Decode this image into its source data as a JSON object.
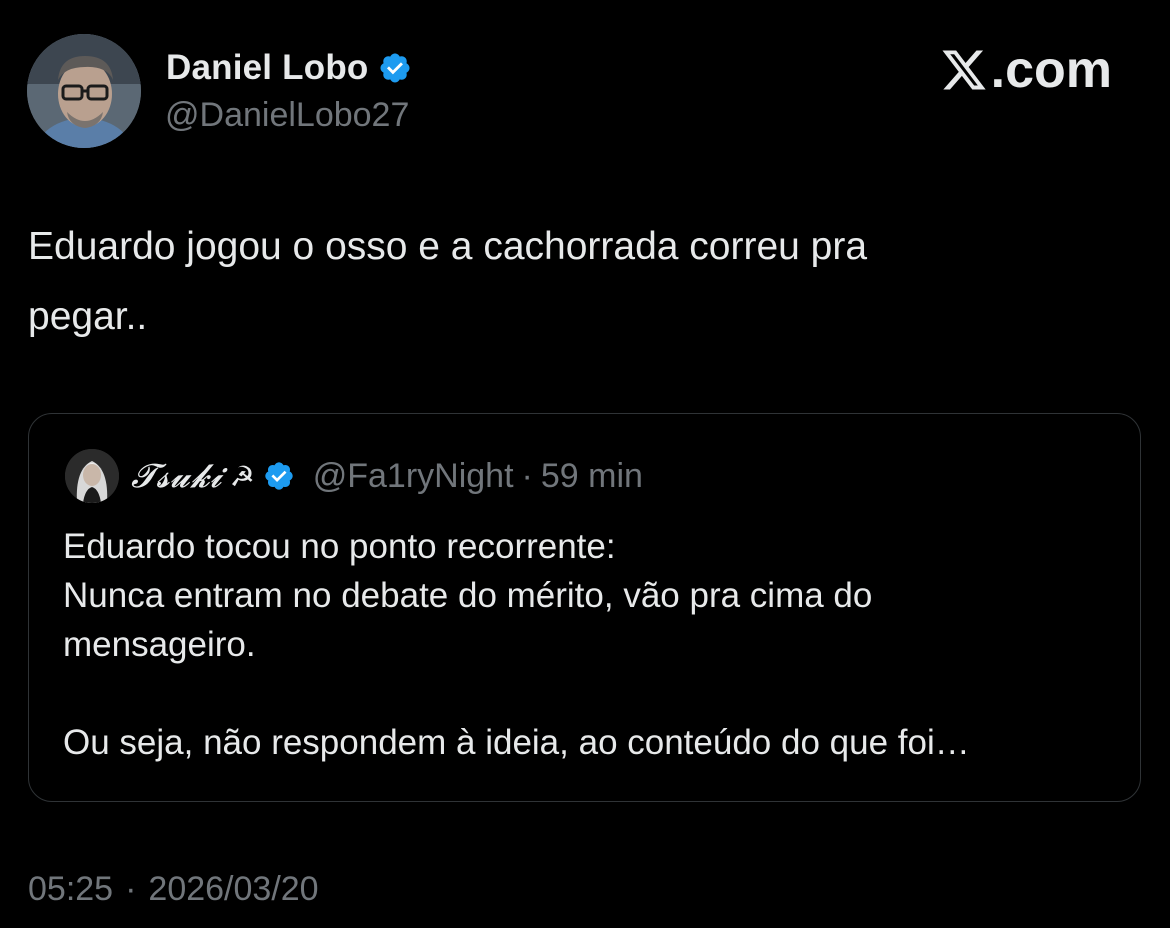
{
  "author": {
    "name": "Daniel Lobo",
    "handle": "@DanielLobo27",
    "verified": true,
    "avatar_icon": "profile-photo"
  },
  "brand": {
    "logo_icon": "x-logo-icon",
    "suffix": ".com"
  },
  "tweet": {
    "text_line1": "Eduardo jogou o osso e a cachorrada correu pra",
    "text_line2": "pegar.."
  },
  "quoted_tweet": {
    "name": "𝓣𝓼𝓾𝓴𝓲",
    "name_emoji": "☭",
    "verified": true,
    "handle": "@Fa1ryNight",
    "separator": "·",
    "time": "59 min",
    "lines": [
      "Eduardo tocou no ponto recorrente:",
      "Nunca entram no debate do mérito, vão pra cima do",
      "mensageiro.",
      "",
      "Ou seja, não respondem à ideia, ao conteúdo do que foi…"
    ]
  },
  "timestamp": {
    "time": "05:25",
    "separator": "·",
    "date": "2026/03/20"
  },
  "colors": {
    "background": "#000000",
    "text_primary": "#e7e9ea",
    "text_secondary": "#71767b",
    "verified_blue": "#1d9bf0",
    "card_border": "#2f3336"
  }
}
